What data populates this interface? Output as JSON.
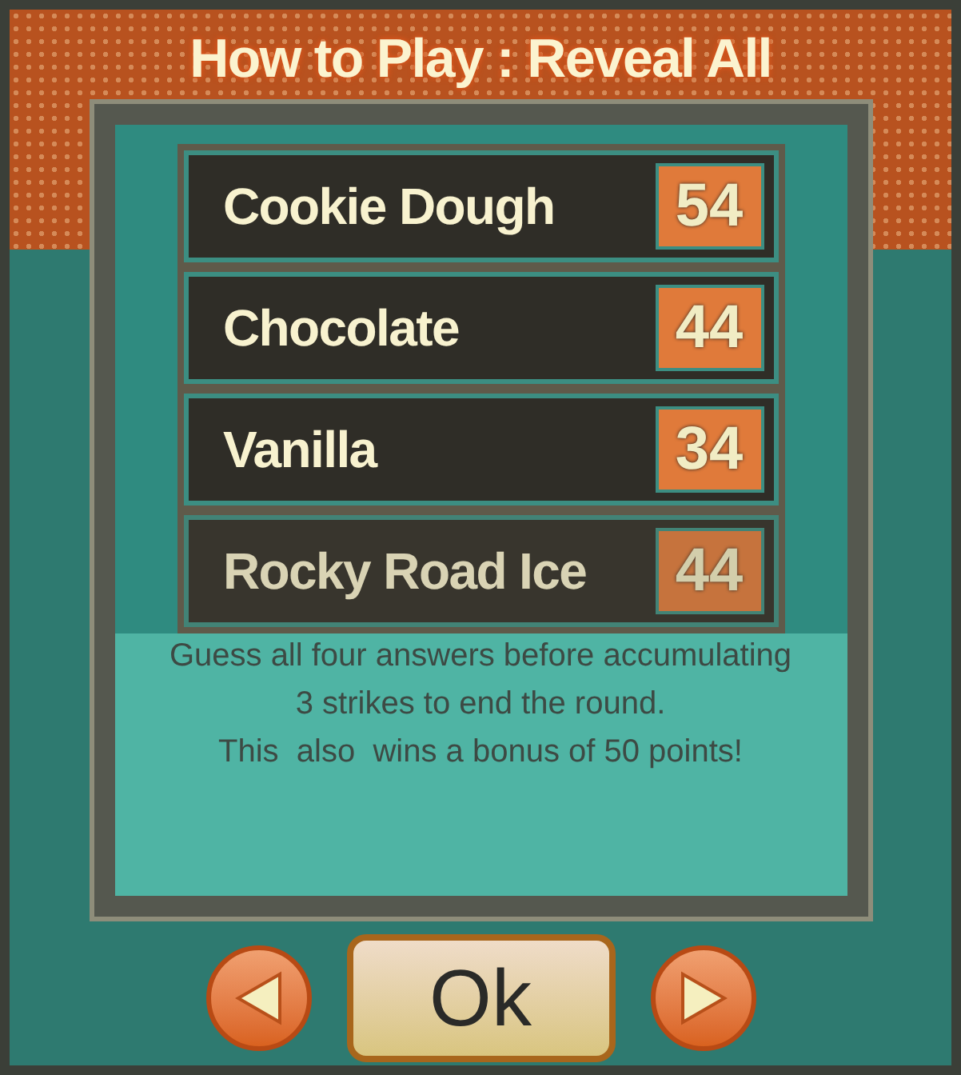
{
  "title": "How to Play : Reveal All",
  "answers": [
    {
      "text": "Cookie Dough",
      "points": "54",
      "faded": false
    },
    {
      "text": "Chocolate",
      "points": "44",
      "faded": false
    },
    {
      "text": "Vanilla",
      "points": "34",
      "faded": false
    },
    {
      "text": "Rocky Road Ice",
      "points": "44",
      "faded": true
    }
  ],
  "instructions": [
    "Guess all four answers before accumulating",
    "3 strikes to end the round.",
    "This  also  wins a bonus of 50 points!"
  ],
  "buttons": {
    "previous": {
      "kind": "prev"
    },
    "ok": {
      "label": "Ok"
    },
    "next": {
      "kind": "next"
    }
  }
}
